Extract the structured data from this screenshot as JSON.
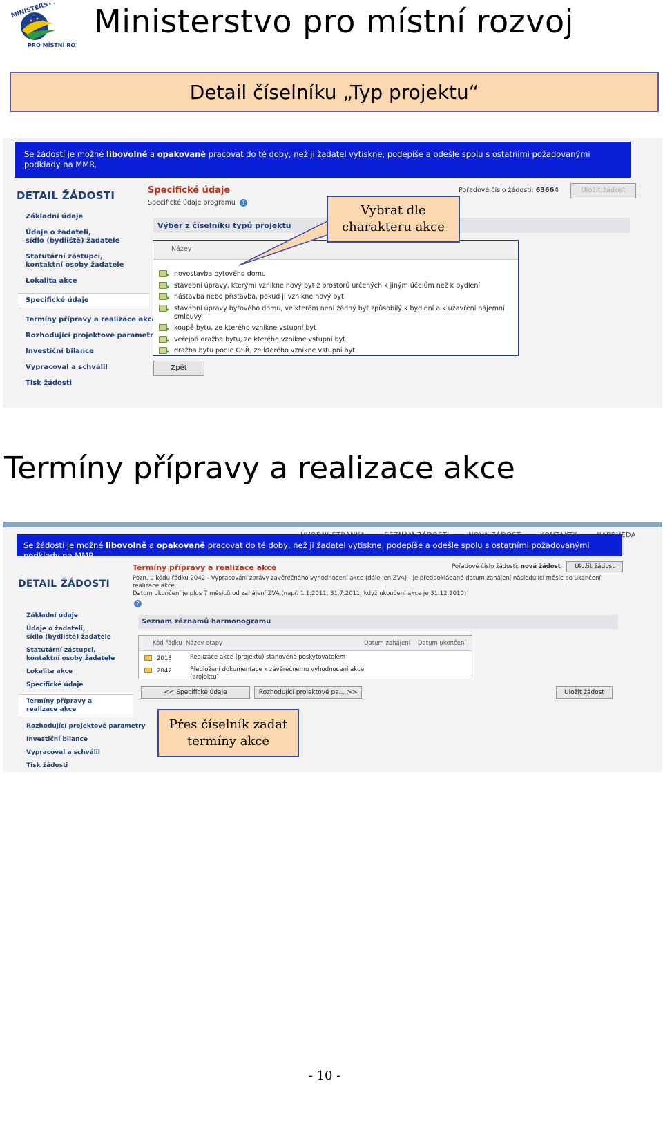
{
  "header": {
    "logo_text": "MINISTERSTVO PRO MÍSTNÍ ROZVOJ",
    "title": "Ministerstvo pro místní rozvoj"
  },
  "section1": {
    "title": "Detail číselníku „Typ projektu“",
    "banner_parts": [
      "Se žádostí je možné ",
      "libovolně",
      " a ",
      "opakovaně",
      " pracovat do té doby, než ji žadatel vytiskne, podepíše a odešle spolu s ostatními požadovanými podklady na MMR."
    ],
    "detail_heading": "DETAIL ŽÁDOSTI",
    "side_nav": [
      "Základní údaje",
      "Údaje o žadateli,\nsídlo (bydliště) žadatele",
      "Statutární zástupci,\nkontaktní osoby žadatele",
      "Lokalita akce",
      "Specifické údaje",
      "Termíny přípravy a realizace akce",
      "Rozhodující projektové parametry",
      "Investiční bilance",
      "Vypracoval a schválil",
      "Tisk žádosti"
    ],
    "active_nav": "Specifické údaje",
    "section_title": "Specifické údaje",
    "section_subtitle": "Specifické údaje programu",
    "order_label": "Pořadové číslo žádosti:",
    "order_value": "63664",
    "save_button": "Uložit žádost",
    "strip_title": "Výběr z číselníku typů projektu",
    "list_header": "Název",
    "items": [
      "novostavba bytového domu",
      "stavební úpravy, kterými vznikne nový byt z prostorů určených k jiným účelům než k bydlení",
      "nástavba nebo přístavba, pokud jí vznikne nový byt",
      "stavební úpravy bytového domu, ve kterém není žádný byt způsobilý k bydlení a k uzavření nájemní smlouvy",
      "koupě bytu, ze kterého vznikne vstupní byt",
      "veřejná dražba bytu, ze kterého vznikne vstupní byt",
      "dražba bytu podle OSŘ, ze kterého vznikne vstupní byt"
    ],
    "back_button": "Zpět",
    "callout": "Vybrat dle charakteru akce"
  },
  "section2": {
    "title": "Termíny přípravy a realizace akce",
    "top_nav": [
      "ÚVODNÍ STRÁNKA",
      "SEZNAM ŽÁDOSTÍ",
      "NOVÁ ŽÁDOST",
      "KONTAKTY",
      "NÁPOVĚDA"
    ],
    "banner_parts": [
      "Se žádostí je možné ",
      "libovolně",
      " a ",
      "opakovaně",
      " pracovat do té doby, než ji žadatel vytiskne, podepíše a odešle spolu s ostatními požadovanými podklady na MMR."
    ],
    "detail_heading": "DETAIL ŽÁDOSTI",
    "side_nav": [
      "Základní údaje",
      "Údaje o žadateli,\nsídlo (bydliště) žadatele",
      "Statutární zástupci,\nkontaktní osoby žadatele",
      "Lokalita akce",
      "Specifické údaje",
      "Termíny přípravy a realizace akce",
      "Rozhodující projektové parametry",
      "Investiční bilance",
      "Vypracoval a schválil",
      "Tisk žádosti"
    ],
    "active_nav": "Termíny přípravy a realizace akce",
    "section_title": "Termíny přípravy a realizace akce",
    "note_line1": "Pozn. u kódu řádku 2042 - Vypracování zprávy závěrečného vyhodnocení akce (dále jen ZVA) - je předpokládané datum zahájení následující měsíc po ukončení realizace akce.",
    "note_line2": "Datum ukončení je plus 7 měsíců od zahájení ZVA (např. 1.1.2011, 31.7.2011, když ukončení akce je 31.12.2010)",
    "order_label": "Pořadové číslo žádosti:",
    "order_value": "nová žádost",
    "save_button": "Uložit žádost",
    "strip_title": "Seznam záznamů harmonogramu",
    "table_headers": [
      "Kód řádku",
      "Název etapy",
      "Datum zahájení",
      "Datum ukončení"
    ],
    "rows": [
      {
        "code": "2018",
        "name": "Realizace akce (projektu) stanovená poskytovatelem"
      },
      {
        "code": "2042",
        "name": "Předložení dokumentace k závěrečnému vyhodnocení akce (projektu)"
      }
    ],
    "prev_button": "<< Specifické údaje",
    "next_button": "Rozhodující projektové pa... >>",
    "save_button_bottom": "Uložit žádost",
    "callout": "Přes číselník zadat termíny akce"
  },
  "footer": {
    "page_number": "- 10 -"
  }
}
